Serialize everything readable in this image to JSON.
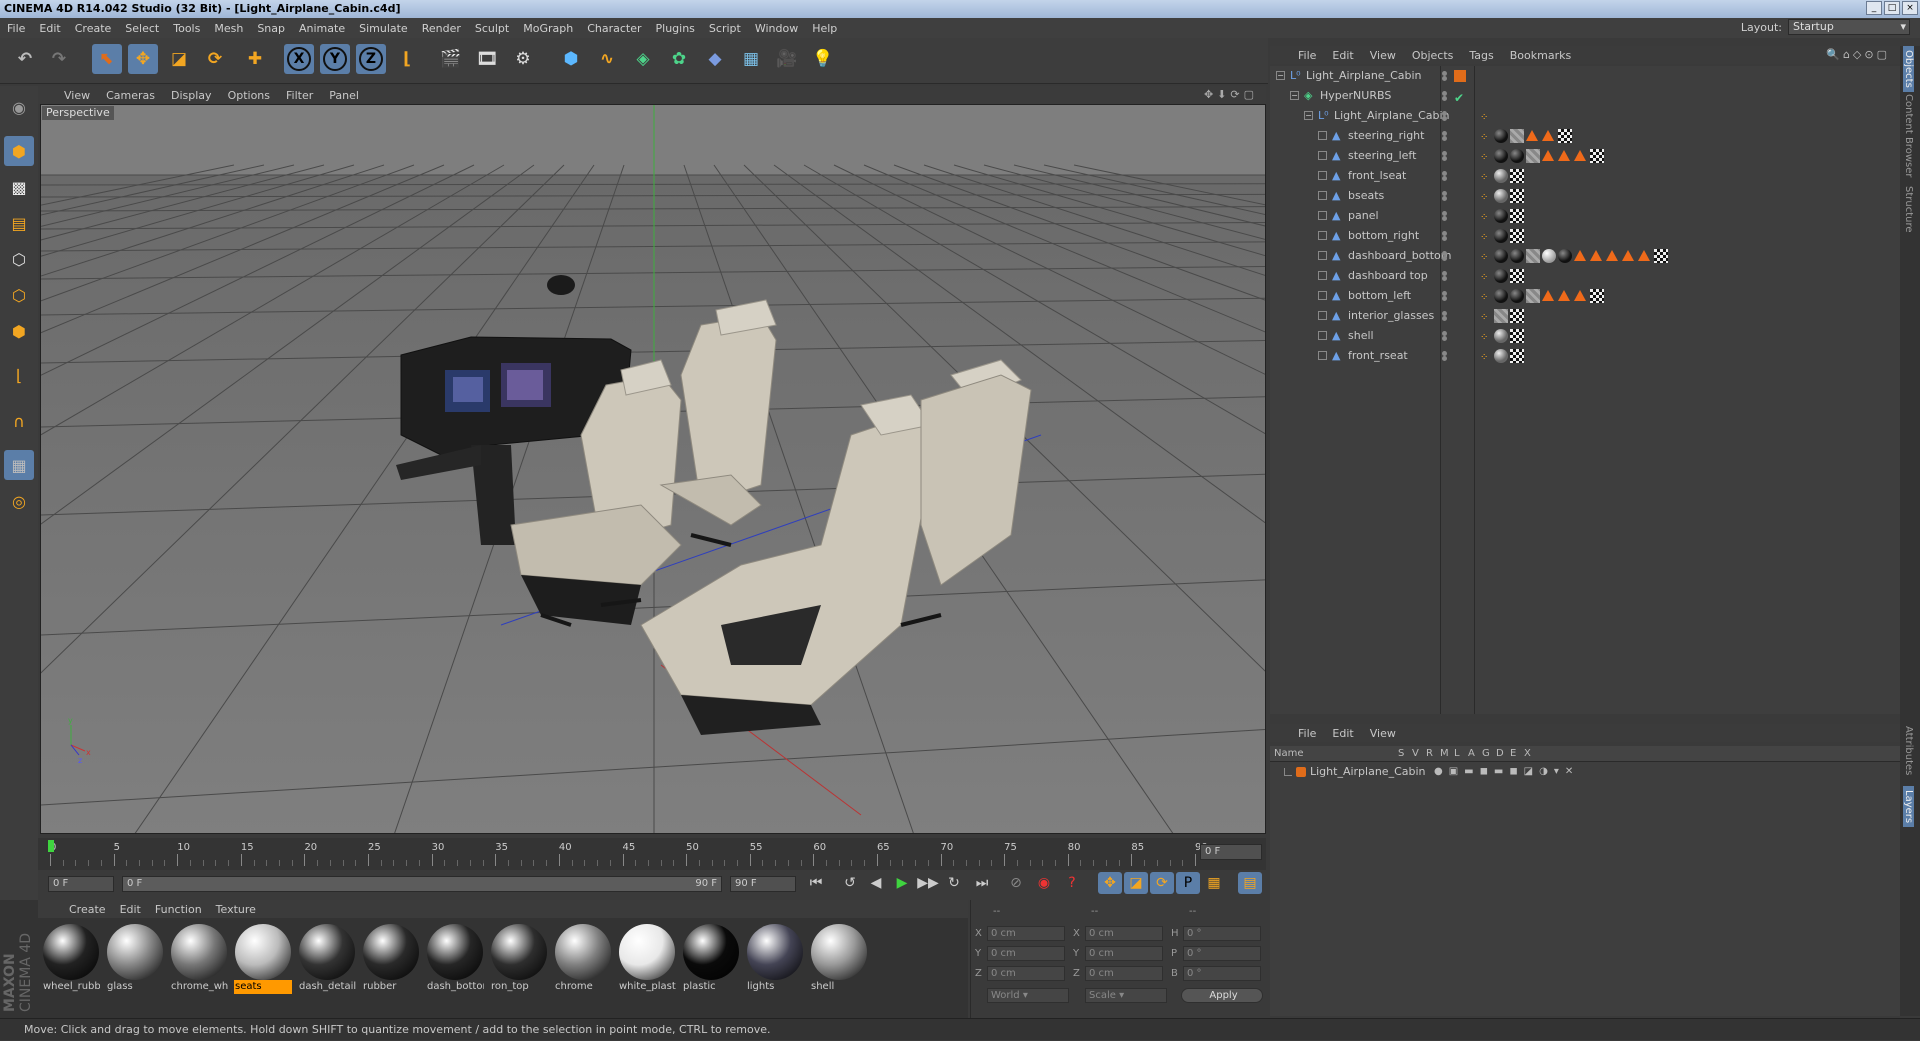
{
  "window": {
    "title": "CINEMA 4D R14.042 Studio (32 Bit) - [Light_Airplane_Cabin.c4d]"
  },
  "menu": [
    "File",
    "Edit",
    "Create",
    "Select",
    "Tools",
    "Mesh",
    "Snap",
    "Animate",
    "Simulate",
    "Render",
    "Sculpt",
    "MoGraph",
    "Character",
    "Plugins",
    "Script",
    "Window",
    "Help"
  ],
  "layout": {
    "label": "Layout:",
    "value": "Startup"
  },
  "viewport": {
    "menu": [
      "View",
      "Cameras",
      "Display",
      "Options",
      "Filter",
      "Panel"
    ],
    "label": "Perspective"
  },
  "timeline": {
    "ticks": [
      "0",
      "5",
      "10",
      "15",
      "20",
      "25",
      "30",
      "35",
      "40",
      "45",
      "50",
      "55",
      "60",
      "65",
      "70",
      "75",
      "80",
      "85",
      "90"
    ],
    "current_frame": "0 F",
    "start_field": "0 F",
    "slider_start": "0 F",
    "slider_end": "90 F",
    "end_field": "90 F"
  },
  "materials": {
    "menu": [
      "Create",
      "Edit",
      "Function",
      "Texture"
    ],
    "items": [
      {
        "name": "wheel_rubb",
        "color": "#222",
        "selected": false
      },
      {
        "name": "glass",
        "color": "#888",
        "selected": false
      },
      {
        "name": "chrome_whi",
        "color": "#777",
        "selected": false
      },
      {
        "name": "seats",
        "color": "#bbb",
        "selected": true
      },
      {
        "name": "dash_detail",
        "color": "#333",
        "selected": false
      },
      {
        "name": "rubber",
        "color": "#2a2a2a",
        "selected": false
      },
      {
        "name": "dash_bottor",
        "color": "#262626",
        "selected": false
      },
      {
        "name": "ron_top",
        "color": "#2e2e2e",
        "selected": false
      },
      {
        "name": "chrome",
        "color": "#808080",
        "selected": false
      },
      {
        "name": "white_plasti",
        "color": "#e8e8e8",
        "selected": false
      },
      {
        "name": "plastic",
        "color": "#0a0a0a",
        "selected": false
      },
      {
        "name": "lights",
        "color": "#445",
        "selected": false
      },
      {
        "name": "shell",
        "color": "#999",
        "selected": false
      }
    ]
  },
  "coordinates": {
    "header": [
      "--",
      "--",
      "--"
    ],
    "rows": [
      {
        "a": "X",
        "av": "0 cm",
        "b": "X",
        "bv": "0 cm",
        "c": "H",
        "cv": "0 °"
      },
      {
        "a": "Y",
        "av": "0 cm",
        "b": "Y",
        "bv": "0 cm",
        "c": "P",
        "cv": "0 °"
      },
      {
        "a": "Z",
        "av": "0 cm",
        "b": "Z",
        "bv": "0 cm",
        "c": "B",
        "cv": "0 °"
      }
    ],
    "mode1": "World",
    "mode2": "Scale",
    "apply": "Apply"
  },
  "status": "Move: Click and drag to move elements. Hold down SHIFT to quantize movement / add to the selection in point mode, CTRL to remove.",
  "object_manager": {
    "menu": [
      "File",
      "Edit",
      "View",
      "Objects",
      "Tags",
      "Bookmarks"
    ],
    "objects": [
      {
        "name": "Light_Airplane_Cabin",
        "depth": 0,
        "type": "null"
      },
      {
        "name": "HyperNURBS",
        "depth": 1,
        "type": "nurbs"
      },
      {
        "name": "Light_Airplane_Cabin",
        "depth": 2,
        "type": "null"
      },
      {
        "name": "steering_right",
        "depth": 3,
        "type": "poly",
        "tags": [
          "dark",
          "grey",
          "tri",
          "tri",
          "check"
        ]
      },
      {
        "name": "steering_left",
        "depth": 3,
        "type": "poly",
        "tags": [
          "dark",
          "dark",
          "grey",
          "tri",
          "tri",
          "tri",
          "check"
        ]
      },
      {
        "name": "front_lseat",
        "depth": 3,
        "type": "poly",
        "tags": [
          "light",
          "check"
        ]
      },
      {
        "name": "bseats",
        "depth": 3,
        "type": "poly",
        "tags": [
          "light",
          "check"
        ]
      },
      {
        "name": "panel",
        "depth": 3,
        "type": "poly",
        "tags": [
          "dark",
          "check"
        ]
      },
      {
        "name": "bottom_right",
        "depth": 3,
        "type": "poly",
        "tags": [
          "dark",
          "check"
        ]
      },
      {
        "name": "dashboard_bottom",
        "depth": 3,
        "type": "poly",
        "tags": [
          "dark",
          "dark",
          "grey",
          "white",
          "dark",
          "tri",
          "tri",
          "tri",
          "tri",
          "tri",
          "check"
        ]
      },
      {
        "name": "dashboard top",
        "depth": 3,
        "type": "poly",
        "tags": [
          "dark",
          "check"
        ]
      },
      {
        "name": "bottom_left",
        "depth": 3,
        "type": "poly",
        "tags": [
          "dark",
          "dark",
          "grey",
          "tri",
          "tri",
          "tri",
          "check"
        ]
      },
      {
        "name": "interior_glasses",
        "depth": 3,
        "type": "poly",
        "tags": [
          "grey",
          "check"
        ]
      },
      {
        "name": "shell",
        "depth": 3,
        "type": "poly",
        "tags": [
          "light",
          "check"
        ]
      },
      {
        "name": "front_rseat",
        "depth": 3,
        "type": "poly",
        "tags": [
          "light",
          "check"
        ]
      }
    ]
  },
  "layer_manager": {
    "menu": [
      "File",
      "Edit",
      "View"
    ],
    "columns": [
      "Name",
      "S",
      "V",
      "R",
      "M",
      "L",
      "A",
      "G",
      "D",
      "E",
      "X"
    ],
    "layers": [
      {
        "name": "Light_Airplane_Cabin"
      }
    ]
  },
  "side_tabs": {
    "top": [
      "Objects",
      "Content Browser",
      "Structure"
    ],
    "bottom": [
      "Attributes",
      "Layers"
    ]
  },
  "brand": [
    "MAXON",
    "CINEMA 4D"
  ]
}
